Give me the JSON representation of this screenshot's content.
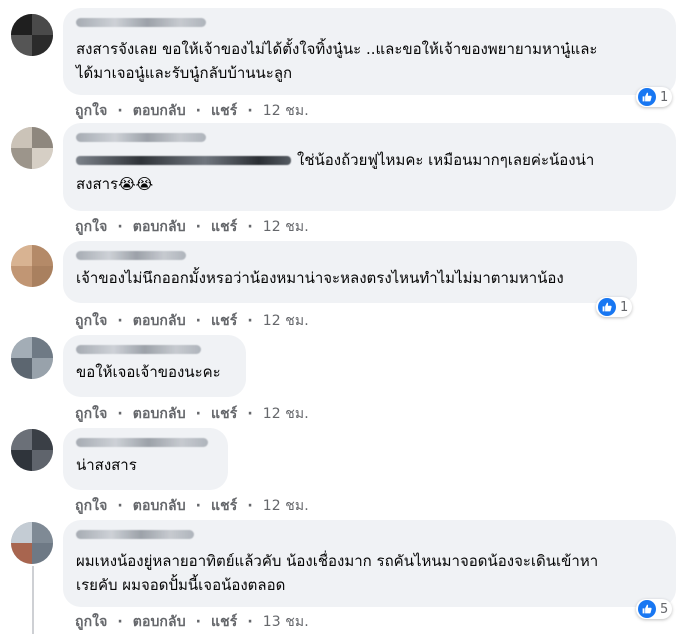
{
  "actions": {
    "like": "ถูกใจ",
    "reply": "ตอบกลับ",
    "share": "แชร์",
    "sep": "·"
  },
  "colors": {
    "bubble": "#f0f2f5",
    "link": "#65676b",
    "like_blue": "#1877f2"
  },
  "comments": [
    {
      "text": "สงสารจังเลย ขอให้เจ้าของไม่ได้ตั้งใจทิ้งนู๋นะ ..และขอให้เจ้าของพยายามหานู๋และ\nได้มาเจอนู๋และรับนู๋กลับบ้านนะลูก",
      "time": "12 ชม.",
      "reactions": "1",
      "reaction_icon": "like-icon"
    },
    {
      "text_before": "",
      "text": "ใช่น้องถ้วยฟูไหมคะ เหมือนมากๆเลยค่ะน้องน่า\nสงสาร",
      "emoji": "😭😭",
      "time": "12 ชม."
    },
    {
      "text": "เจ้าของไม่นึกออกมั้งหรอว่าน้องหมาน่าจะหลงตรงไหนทำไมไม่มาตามหาน้อง",
      "time": "12 ชม.",
      "reactions": "1",
      "reaction_icon": "like-icon"
    },
    {
      "text": "ขอให้เจอเจ้าของนะคะ",
      "time": "12 ชม."
    },
    {
      "text": "น่าสงสาร",
      "time": "12 ชม."
    },
    {
      "text": "ผมเหงน้องยู่หลายอาทิตย์แล้วคับ น้องเชื่องมาก รถคันไหนมาจอดน้องจะเดินเข้าหา\nเรยคับ ผมจอดปั้มนี้เจอน้องตลอด",
      "time": "13 ชม.",
      "reactions": "5",
      "reaction_icon": "like-icon"
    }
  ]
}
